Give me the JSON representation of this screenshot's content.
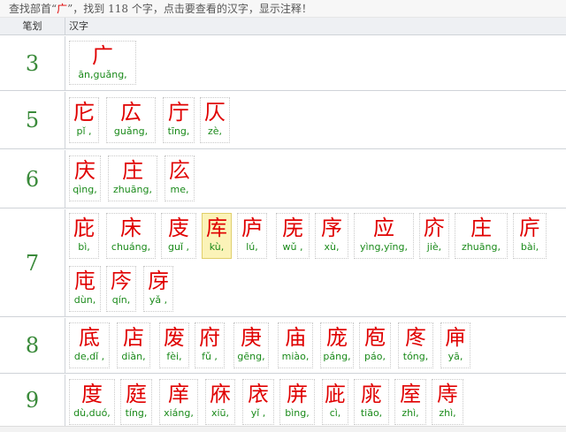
{
  "topbar": {
    "prefix": "查找部首“",
    "radical": "广",
    "suffix": "”，找到 118 个字，点击要查看的汉字，显示注释！"
  },
  "header": {
    "stroke": "笔划",
    "char": "汉字"
  },
  "rows": [
    {
      "stroke": "3",
      "chars": [
        {
          "hz": "广",
          "py": "ān,guǎng,"
        }
      ]
    },
    {
      "stroke": "5",
      "chars": [
        {
          "hz": "庀",
          "py": "pǐ ,"
        },
        {
          "hz": "広",
          "py": "guǎng,"
        },
        {
          "hz": "庁",
          "py": "tīng,"
        },
        {
          "hz": "仄",
          "py": "zè,"
        }
      ]
    },
    {
      "stroke": "6",
      "chars": [
        {
          "hz": "庆",
          "py": "qìng,"
        },
        {
          "hz": "庄",
          "py": "zhuāng,"
        },
        {
          "hz": "庅",
          "py": "me,"
        }
      ]
    },
    {
      "stroke": "7",
      "chars": [
        {
          "hz": "庇",
          "py": "bì,"
        },
        {
          "hz": "床",
          "py": "chuáng,"
        },
        {
          "hz": "庋",
          "py": "guǐ ,"
        },
        {
          "hz": "库",
          "py": "kù,"
        },
        {
          "hz": "庐",
          "py": "lú,"
        },
        {
          "hz": "庑",
          "py": "wǔ ,"
        },
        {
          "hz": "序",
          "py": "xù,"
        },
        {
          "hz": "应",
          "py": "yìng,yīng,"
        },
        {
          "hz": "庎",
          "py": "jiè,"
        },
        {
          "hz": "庄",
          "py": "zhuāng,"
        },
        {
          "hz": "庍",
          "py": "bài,"
        },
        {
          "hz": "庉",
          "py": "dùn,"
        },
        {
          "hz": "庈",
          "py": "qín,"
        },
        {
          "hz": "庌",
          "py": "yǎ ,"
        }
      ]
    },
    {
      "stroke": "8",
      "chars": [
        {
          "hz": "底",
          "py": "de,dǐ ,"
        },
        {
          "hz": "店",
          "py": "diàn,"
        },
        {
          "hz": "废",
          "py": "fèi,"
        },
        {
          "hz": "府",
          "py": "fǔ ,"
        },
        {
          "hz": "庚",
          "py": "gēng,"
        },
        {
          "hz": "庙",
          "py": "miào,"
        },
        {
          "hz": "庞",
          "py": "páng,"
        },
        {
          "hz": "庖",
          "py": "páo,"
        },
        {
          "hz": "庝",
          "py": "tóng,"
        },
        {
          "hz": "庘",
          "py": "yā,"
        }
      ]
    },
    {
      "stroke": "9",
      "chars": [
        {
          "hz": "度",
          "py": "dù,duó,"
        },
        {
          "hz": "庭",
          "py": "tíng,"
        },
        {
          "hz": "庠",
          "py": "xiáng,"
        },
        {
          "hz": "庥",
          "py": "xiū,"
        },
        {
          "hz": "庡",
          "py": "yǐ ,"
        },
        {
          "hz": "庰",
          "py": "bìng,"
        },
        {
          "hz": "庛",
          "py": "cì,"
        },
        {
          "hz": "庣",
          "py": "tiāo,"
        },
        {
          "hz": "庢",
          "py": "zhì,"
        },
        {
          "hz": "庤",
          "py": "zhì,"
        }
      ]
    }
  ],
  "selected_char": "库",
  "colors": {
    "char": "#e00000",
    "pinyin": "#1a8a1a",
    "stroke": "#3a8a3a",
    "selected_bg": "#fbf3b8"
  }
}
